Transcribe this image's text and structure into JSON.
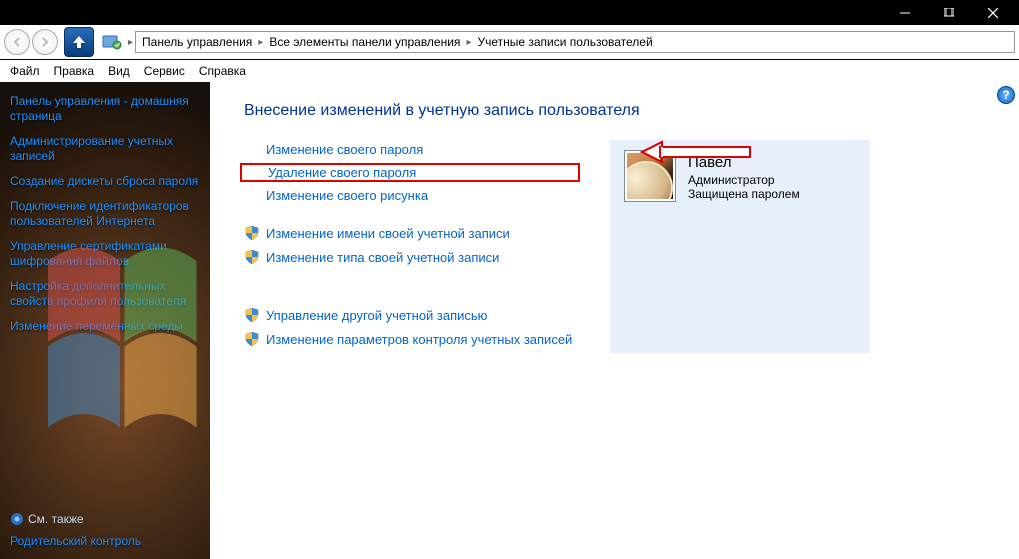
{
  "titlebar": {},
  "nav": {
    "breadcrumbs": [
      "Панель управления",
      "Все элементы панели управления",
      "Учетные записи пользователей"
    ]
  },
  "menu": {
    "items": [
      "Файл",
      "Правка",
      "Вид",
      "Сервис",
      "Справка"
    ]
  },
  "sidebar": {
    "links": [
      "Панель управления - домашняя страница",
      "Администрирование учетных записей",
      "Создание дискеты сброса пароля",
      "Подключение идентификаторов пользователей Интернета",
      "Управление сертификатами шифрования файлов",
      "Настройка дополнительных свойств профиля пользователя",
      "Изменение переменных среды"
    ],
    "see_also_label": "См. также",
    "see_also_links": [
      "Родительский контроль"
    ]
  },
  "main": {
    "heading": "Внесение изменений в учетную запись пользователя",
    "actions_primary": [
      {
        "label": "Изменение своего пароля",
        "shield": false,
        "highlight": false
      },
      {
        "label": "Удаление своего пароля",
        "shield": false,
        "highlight": true
      },
      {
        "label": "Изменение своего рисунка",
        "shield": false,
        "highlight": false
      },
      {
        "label": "Изменение имени своей учетной записи",
        "shield": true,
        "highlight": false
      },
      {
        "label": "Изменение типа своей учетной записи",
        "shield": true,
        "highlight": false
      }
    ],
    "actions_secondary": [
      {
        "label": "Управление другой учетной записью",
        "shield": true
      },
      {
        "label": "Изменение параметров контроля учетных записей",
        "shield": true
      }
    ],
    "user": {
      "name": "Павел",
      "role": "Администратор",
      "protected": "Защищена паролем"
    }
  }
}
